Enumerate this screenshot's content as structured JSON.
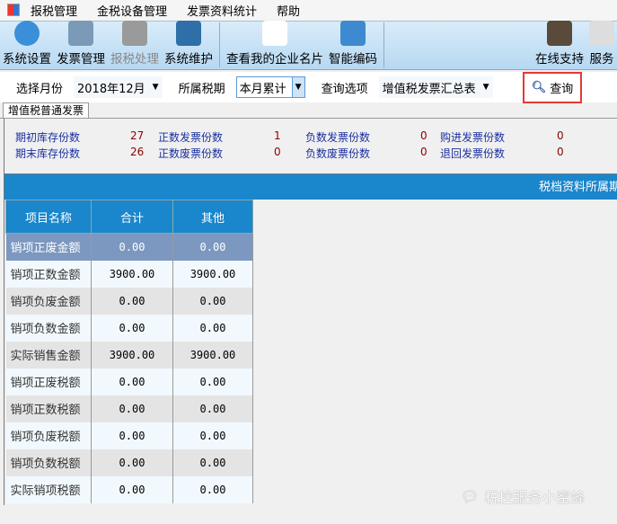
{
  "menu": [
    "报税管理",
    "金税设备管理",
    "发票资料统计",
    "帮助"
  ],
  "toolbar": [
    {
      "label": "系统设置",
      "icon": "gear-icon",
      "color": "#3a8fd8",
      "disabled": false
    },
    {
      "label": "发票管理",
      "icon": "calendar-icon",
      "color": "#7a9ab8",
      "disabled": false
    },
    {
      "label": "报税处理",
      "icon": "monitor-icon",
      "color": "#9a9a9a",
      "disabled": true
    },
    {
      "label": "系统维护",
      "icon": "folder-gear-icon",
      "color": "#2f6fa8",
      "disabled": false
    },
    {
      "label": "查看我的企业名片",
      "icon": "magnifier-icon",
      "color": "#ffffff",
      "disabled": false
    },
    {
      "label": "智能编码",
      "icon": "cloud-icon",
      "color": "#3d8ad0",
      "disabled": false
    },
    {
      "label": "在线支持",
      "icon": "support-person-icon",
      "color": "#5a4a3a",
      "disabled": false
    },
    {
      "label": "服务",
      "icon": "notebook-icon",
      "color": "#dddddd",
      "disabled": false
    }
  ],
  "query": {
    "month_label": "选择月份",
    "month_value": "2018年12月",
    "period_label": "所属税期",
    "period_value": "本月累计",
    "option_label": "查询选项",
    "option_value": "增值税发票汇总表",
    "query_button": "查询"
  },
  "tab": "增值税普通发票",
  "info": [
    {
      "label": "期初库存份数",
      "value": "27"
    },
    {
      "label": "正数发票份数",
      "value": "1"
    },
    {
      "label": "负数发票份数",
      "value": "0"
    },
    {
      "label": "购进发票份数",
      "value": "0"
    },
    {
      "label": "期末库存份数",
      "value": "26"
    },
    {
      "label": "正数废票份数",
      "value": "0"
    },
    {
      "label": "负数废票份数",
      "value": "0"
    },
    {
      "label": "退回发票份数",
      "value": "0"
    }
  ],
  "band_title": "税档资料所属期",
  "table": {
    "headers": [
      "项目名称",
      "合计",
      "其他"
    ],
    "rows": [
      [
        "销项正废金额",
        "0.00",
        "0.00"
      ],
      [
        "销项正数金额",
        "3900.00",
        "3900.00"
      ],
      [
        "销项负废金额",
        "0.00",
        "0.00"
      ],
      [
        "销项负数金额",
        "0.00",
        "0.00"
      ],
      [
        "实际销售金额",
        "3900.00",
        "3900.00"
      ],
      [
        "销项正废税额",
        "0.00",
        "0.00"
      ],
      [
        "销项正数税额",
        "0.00",
        "0.00"
      ],
      [
        "销项负废税额",
        "0.00",
        "0.00"
      ],
      [
        "销项负数税额",
        "0.00",
        "0.00"
      ],
      [
        "实际销项税额",
        "0.00",
        "0.00"
      ]
    ],
    "selected_row": 0
  },
  "watermark": "税控服务小蜜蜂"
}
